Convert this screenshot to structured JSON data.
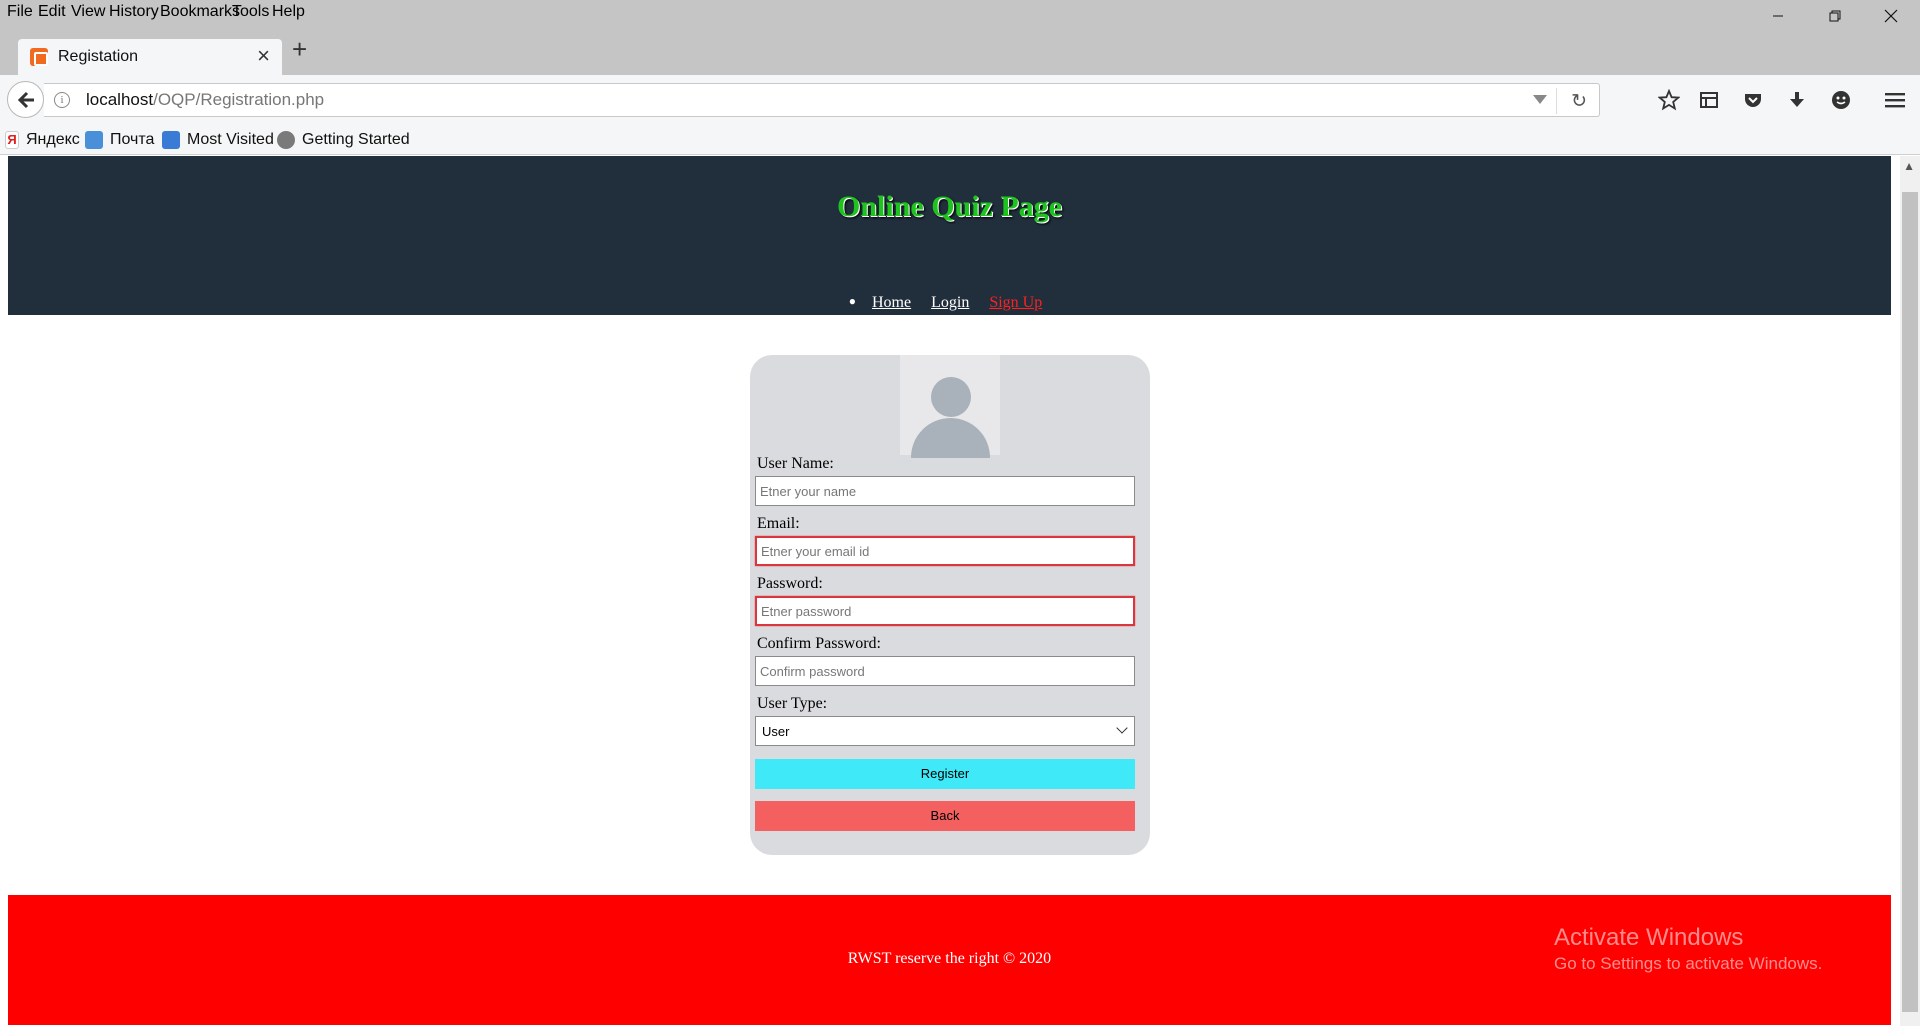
{
  "menu": [
    {
      "label": "File"
    },
    {
      "label": "Edit"
    },
    {
      "label": "View"
    },
    {
      "label": "History"
    },
    {
      "label": "Bookmarks"
    },
    {
      "label": "Tools"
    },
    {
      "label": "Help"
    }
  ],
  "tab": {
    "title": "Registation",
    "close": "×",
    "new_tab": "+"
  },
  "urlbar": {
    "host": "localhost",
    "path": "/OQP/Registration.php",
    "info": "i"
  },
  "bookmarks": [
    {
      "label": "Яндекс",
      "color": "#e02020"
    },
    {
      "label": "Почта",
      "color": "#4a90d9"
    },
    {
      "label": "Most Visited",
      "color": "#3a7bd5"
    },
    {
      "label": "Getting Started",
      "color": "#7a7a7a"
    }
  ],
  "site": {
    "title": "Online Quiz Page",
    "nav": {
      "home": "Home",
      "login": "Login",
      "signup": "Sign Up"
    }
  },
  "form": {
    "username": {
      "label": "User Name:",
      "placeholder": "Etner your name",
      "value": ""
    },
    "email": {
      "label": "Email:",
      "placeholder": "Etner your email id",
      "value": ""
    },
    "password": {
      "label": "Password:",
      "placeholder": "Etner password",
      "value": ""
    },
    "confirm": {
      "label": "Confirm Password:",
      "placeholder": "Confirm password",
      "value": ""
    },
    "usertype": {
      "label": "User Type:",
      "selected": "User"
    },
    "register": "Register",
    "back": "Back"
  },
  "footer": {
    "text": "RWST reserve the right © 2020"
  },
  "watermark": {
    "title": "Activate Windows",
    "subtitle": "Go to Settings to activate Windows."
  },
  "colors": {
    "header_bg": "#212f3d",
    "title_green": "#1fc31f",
    "nav_active": "#ff2020",
    "card_bg": "#dadbde",
    "register_btn": "#3fe9f7",
    "back_btn": "#f46060",
    "footer_bg": "#ff0000"
  }
}
